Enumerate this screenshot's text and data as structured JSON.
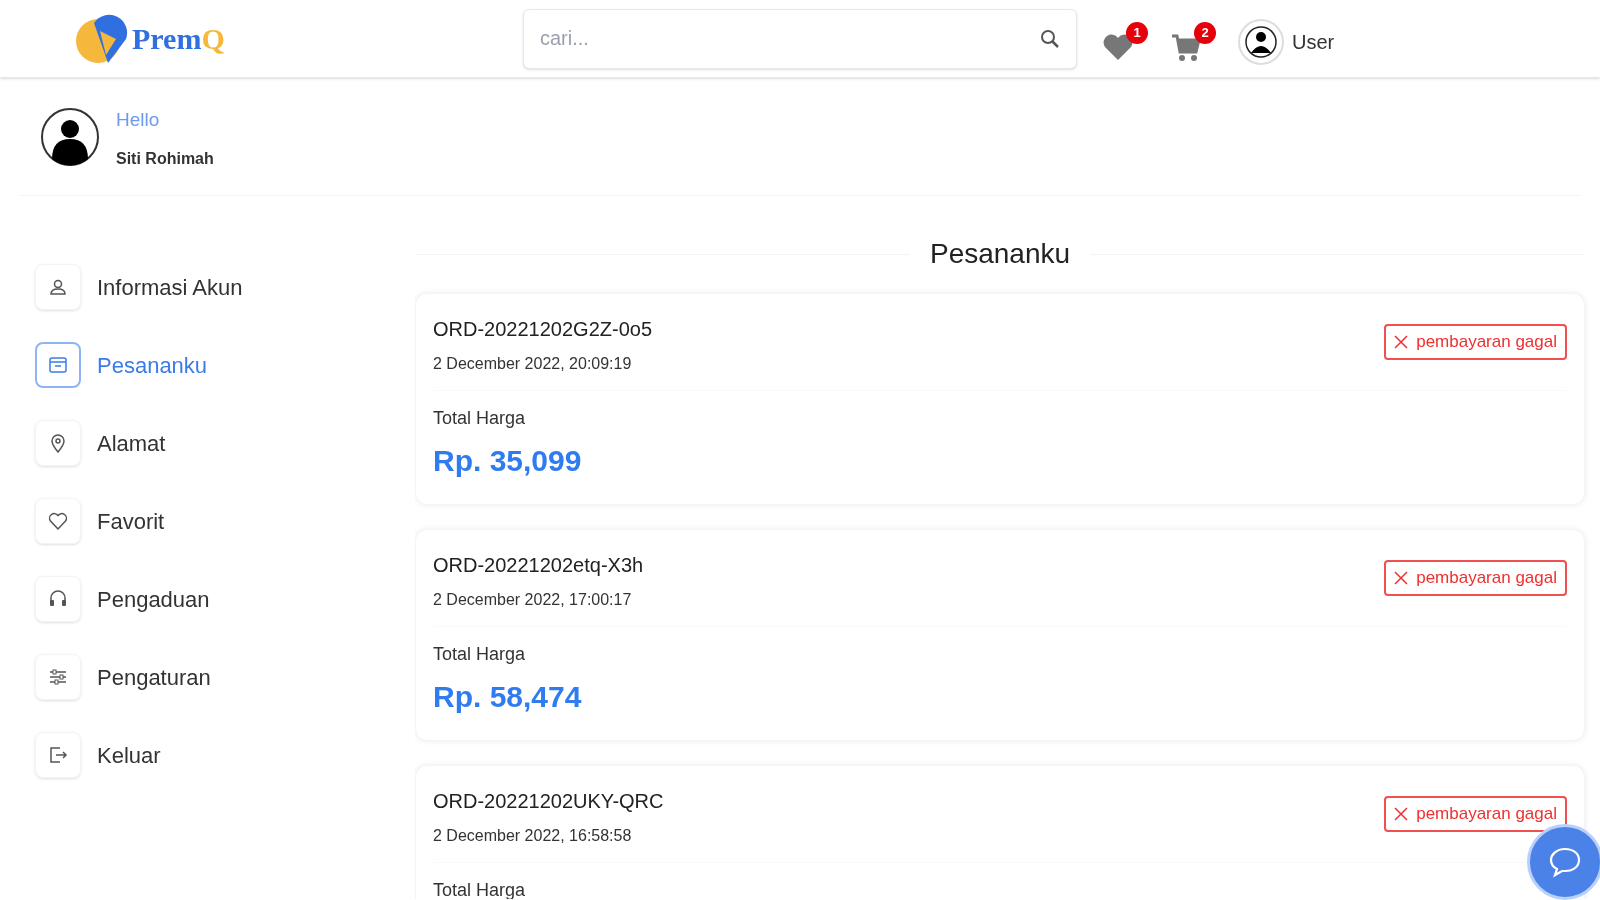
{
  "header": {
    "logo": {
      "text_main": "Prem",
      "text_accent": "Q"
    },
    "search": {
      "placeholder": "cari..."
    },
    "favorites": {
      "count": "1"
    },
    "cart": {
      "count": "2"
    },
    "user": {
      "label": "User"
    }
  },
  "profile": {
    "greeting": "Hello",
    "name": "Siti Rohimah"
  },
  "sidebar": {
    "items": [
      {
        "label": "Informasi Akun",
        "selected": false
      },
      {
        "label": "Pesananku",
        "selected": true
      },
      {
        "label": "Alamat",
        "selected": false
      },
      {
        "label": "Favorit",
        "selected": false
      },
      {
        "label": "Pengaduan",
        "selected": false
      },
      {
        "label": "Pengaturan",
        "selected": false
      },
      {
        "label": "Keluar",
        "selected": false
      }
    ]
  },
  "orders": {
    "title": "Pesananku",
    "items": [
      {
        "id": "ORD-20221202G2Z-0o5",
        "date": "2 December 2022, 20:09:19",
        "status": "pembayaran gagal",
        "total_label": "Total Harga",
        "total": "Rp. 35,099"
      },
      {
        "id": "ORD-20221202etq-X3h",
        "date": "2 December 2022, 17:00:17",
        "status": "pembayaran gagal",
        "total_label": "Total Harga",
        "total": "Rp. 58,474"
      },
      {
        "id": "ORD-20221202UKY-QRC",
        "date": "2 December 2022, 16:58:58",
        "status": "pembayaran gagal",
        "total_label": "Total Harga"
      }
    ]
  }
}
